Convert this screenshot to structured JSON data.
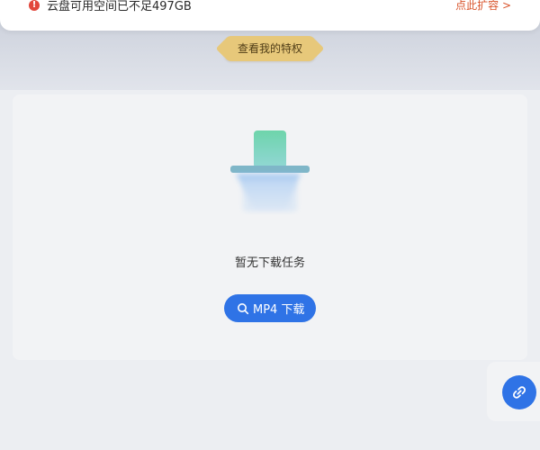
{
  "alert": {
    "icon": "warning-icon",
    "message": "云盘可用空间已不足497GB",
    "action": "点此扩容 >",
    "colors": {
      "icon": "#e2463b",
      "action": "#d8532a"
    }
  },
  "privilege": {
    "label": "查看我的特权"
  },
  "empty_state": {
    "illustration": "download-empty-icon",
    "message": "暂无下载任务"
  },
  "actions": {
    "mp4_download": {
      "label": "MP4 下载",
      "icon": "search-icon"
    },
    "floating_link": {
      "icon": "link-icon"
    }
  },
  "colors": {
    "primary": "#2f73e6",
    "gold": "#e7c87a",
    "page_bg": "#eceef2",
    "card_bg": "#f2f3f5"
  }
}
